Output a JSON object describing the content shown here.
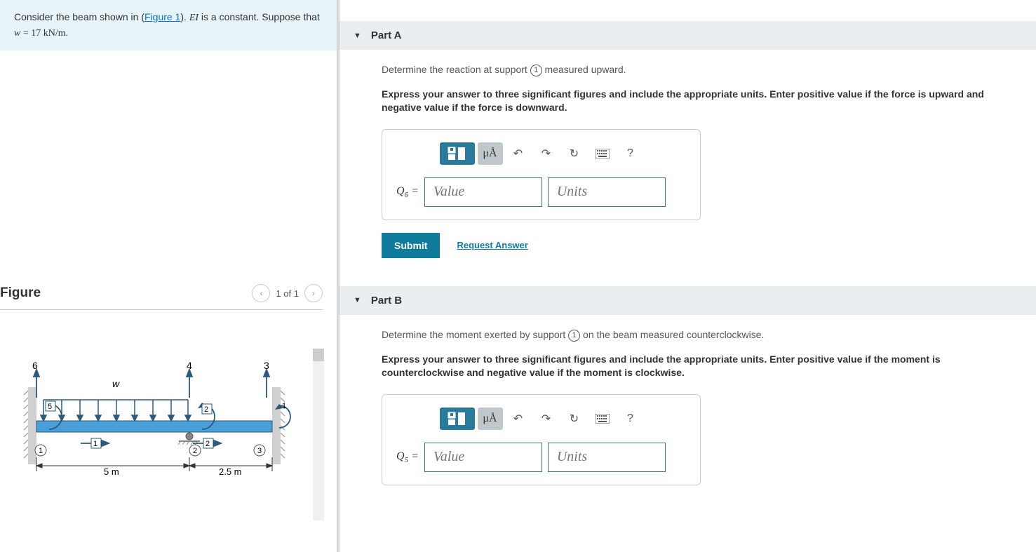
{
  "problem": {
    "intro": "Consider the beam shown in (",
    "figure_link": "Figure 1",
    "intro2": "). ",
    "ei_var": "EI",
    "intro3": " is a constant. Suppose that ",
    "w_var": "w",
    "eq": " = 17 kN/m.",
    "w_value": "17",
    "w_units": "kN/m"
  },
  "figure": {
    "title": "Figure",
    "count": "1 of 1",
    "labels": {
      "n1": "1",
      "n2": "2",
      "n3": "3",
      "n4": "4",
      "n5": "5",
      "n6": "6",
      "w": "w",
      "d1": "5 m",
      "d2": "2.5 m",
      "s1": "1",
      "s2": "2",
      "s3": "3"
    }
  },
  "partA": {
    "title": "Part A",
    "question_pre": "Determine the reaction at support ",
    "question_num": "1",
    "question_post": " measured upward.",
    "instruction": "Express your answer to three significant figures and include the appropriate units. Enter positive value if the force is upward and negative value if the force is downward.",
    "var": "Q",
    "sub": "6",
    "value_ph": "Value",
    "units_ph": "Units",
    "submit": "Submit",
    "request": "Request Answer"
  },
  "partB": {
    "title": "Part B",
    "question_pre": "Determine the moment exerted by support ",
    "question_num": "1",
    "question_post": " on the beam measured counterclockwise.",
    "instruction": "Express your answer to three significant figures and include the appropriate units. Enter positive value if the moment is counterclockwise and negative value if the moment is clockwise.",
    "var": "Q",
    "sub": "5",
    "value_ph": "Value",
    "units_ph": "Units"
  },
  "toolbar": {
    "mua": "μÅ",
    "help": "?"
  }
}
